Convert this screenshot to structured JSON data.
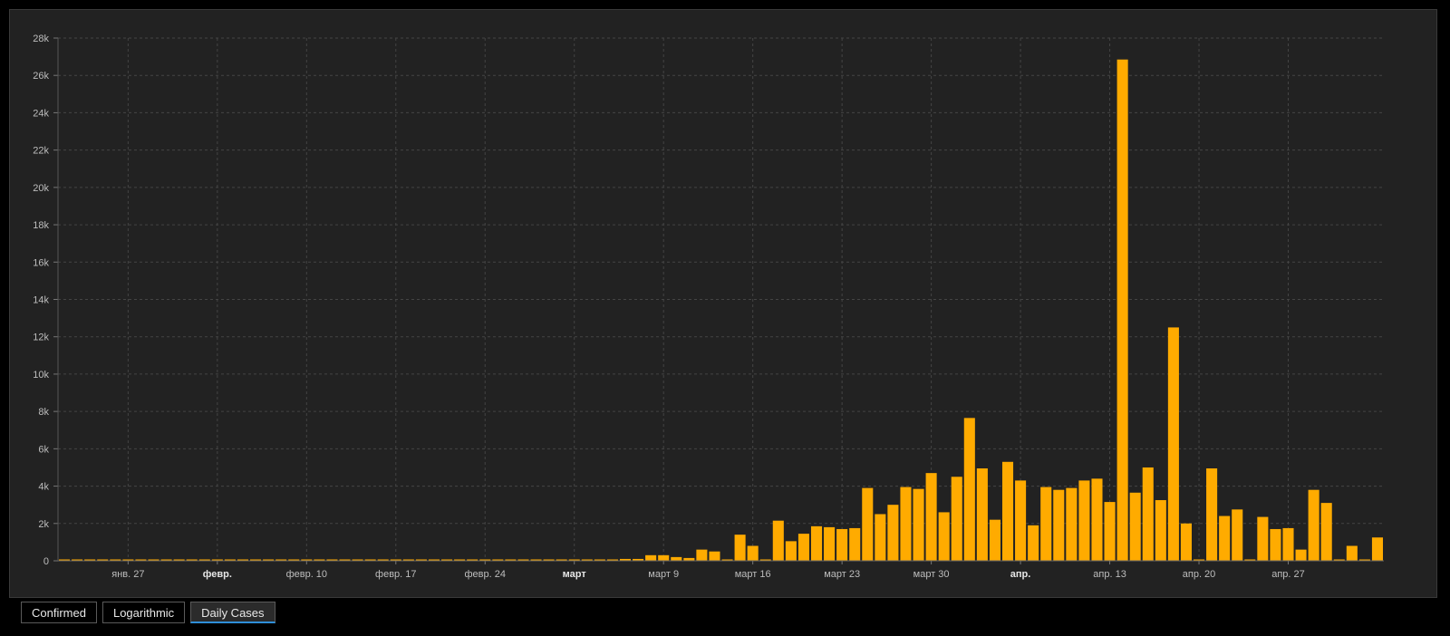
{
  "tabs": [
    {
      "label": "Confirmed",
      "active": false
    },
    {
      "label": "Logarithmic",
      "active": false
    },
    {
      "label": "Daily Cases",
      "active": true
    }
  ],
  "colors": {
    "bar": "#FFAB00",
    "grid": "#444444",
    "background": "#222222",
    "accent": "#2F8FD8"
  },
  "chart_data": {
    "type": "bar",
    "title": "",
    "xlabel": "",
    "ylabel": "",
    "ylim": [
      0,
      28000
    ],
    "grid": true,
    "x_start": "2020-01-22",
    "y_ticks": [
      0,
      2000,
      4000,
      6000,
      8000,
      10000,
      12000,
      14000,
      16000,
      18000,
      20000,
      22000,
      24000,
      26000,
      28000
    ],
    "y_tick_labels": [
      "0",
      "2k",
      "4k",
      "6k",
      "8k",
      "10k",
      "12k",
      "14k",
      "16k",
      "18k",
      "20k",
      "22k",
      "24k",
      "26k",
      "28k"
    ],
    "x_ticks": [
      {
        "date": "2020-01-27",
        "label": "янв. 27",
        "bold": false
      },
      {
        "date": "2020-02-03",
        "label": "февр.",
        "bold": true
      },
      {
        "date": "2020-02-10",
        "label": "февр. 10",
        "bold": false
      },
      {
        "date": "2020-02-17",
        "label": "февр. 17",
        "bold": false
      },
      {
        "date": "2020-02-24",
        "label": "февр. 24",
        "bold": false
      },
      {
        "date": "2020-03-02",
        "label": "март",
        "bold": true
      },
      {
        "date": "2020-03-09",
        "label": "март 9",
        "bold": false
      },
      {
        "date": "2020-03-16",
        "label": "март 16",
        "bold": false
      },
      {
        "date": "2020-03-23",
        "label": "март 23",
        "bold": false
      },
      {
        "date": "2020-03-30",
        "label": "март 30",
        "bold": false
      },
      {
        "date": "2020-04-06",
        "label": "апр.",
        "bold": true
      },
      {
        "date": "2020-04-13",
        "label": "апр. 13",
        "bold": false
      },
      {
        "date": "2020-04-20",
        "label": "апр. 20",
        "bold": false
      },
      {
        "date": "2020-04-27",
        "label": "апр. 27",
        "bold": false
      }
    ],
    "series": [
      {
        "values": [
          0,
          0,
          0,
          0,
          0,
          0,
          0,
          0,
          0,
          0,
          0,
          0,
          0,
          0,
          0,
          0,
          0,
          0,
          0,
          0,
          0,
          0,
          0,
          0,
          0,
          0,
          0,
          0,
          0,
          0,
          0,
          0,
          0,
          0,
          0,
          0,
          0,
          0,
          0,
          0,
          60,
          70,
          40,
          30,
          100,
          100,
          300,
          300,
          200,
          150,
          600,
          500,
          20,
          1400,
          800,
          50,
          2150,
          1050,
          1450,
          1850,
          1800,
          1700,
          1750,
          3900,
          2500,
          3000,
          3950,
          3850,
          4700,
          2600,
          4500,
          7650,
          4950,
          2200,
          5300,
          4300,
          1900,
          3950,
          3800,
          3900,
          4300,
          4400,
          3150,
          26850,
          3650,
          5000,
          3250,
          12500,
          2000,
          0,
          4950,
          2400,
          2750,
          0,
          2350,
          1700,
          1750,
          600,
          3800,
          3100,
          0,
          800,
          0,
          1250
        ]
      }
    ]
  }
}
